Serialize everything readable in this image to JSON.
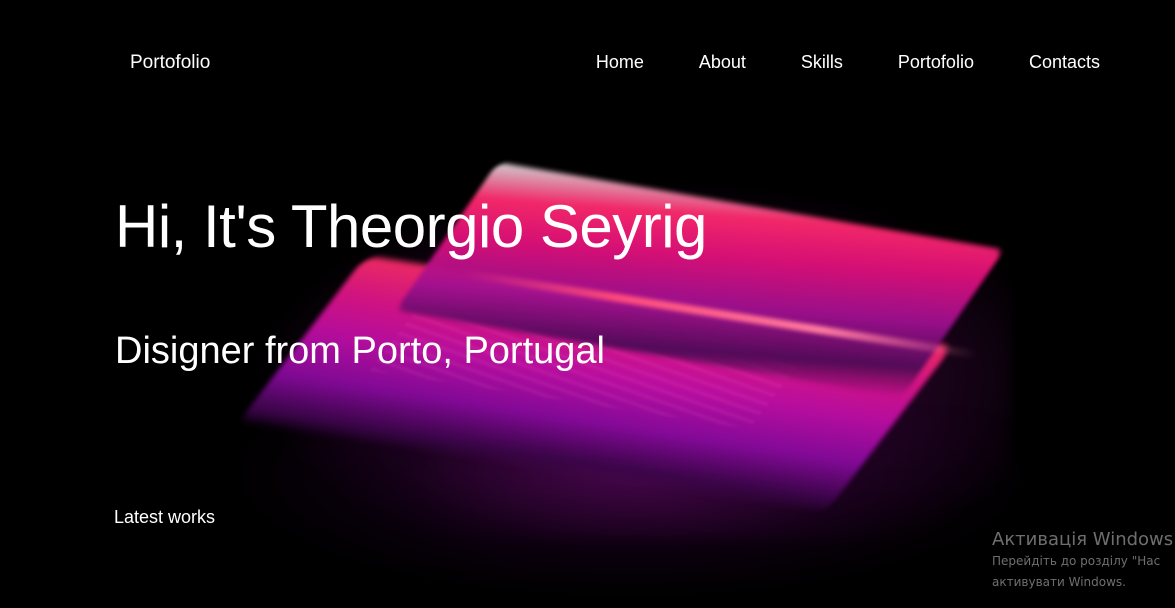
{
  "header": {
    "brand": "Portofolio",
    "nav": [
      {
        "label": "Home"
      },
      {
        "label": "About"
      },
      {
        "label": "Skills"
      },
      {
        "label": "Portofolio"
      },
      {
        "label": "Contacts"
      }
    ]
  },
  "hero": {
    "title": "Hi, It's Theorgio Seyrig",
    "subtitle": "Disigner from Porto, Portugal",
    "latest_works": "Latest works"
  },
  "watermark": {
    "title": "Активація Windows",
    "line1": "Перейдіть до розділу \"Нас",
    "line2": "активувати Windows."
  },
  "colors": {
    "background": "#000000",
    "text": "#ffffff",
    "accent_pink": "#ff2a6e",
    "accent_magenta": "#c20ea8",
    "accent_purple": "#8a0aa0"
  }
}
